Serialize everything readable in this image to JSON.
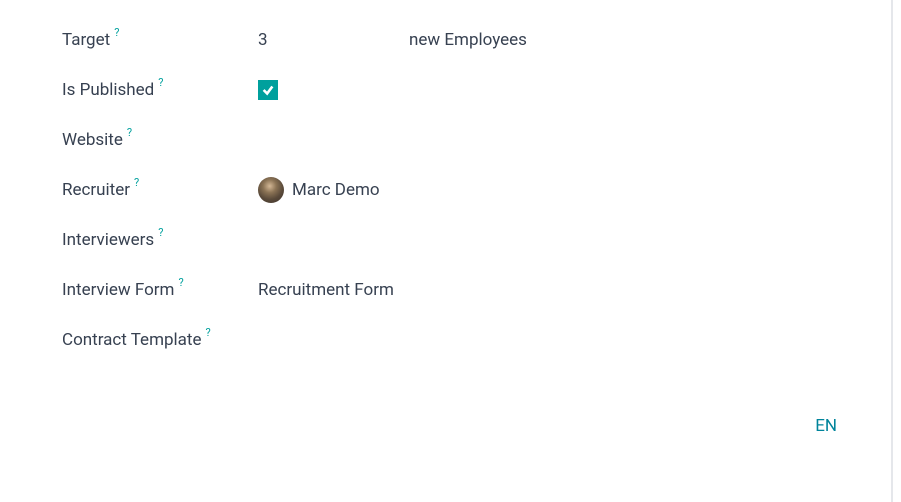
{
  "fields": {
    "target": {
      "label": "Target",
      "value": "3",
      "suffix": "new Employees"
    },
    "is_published": {
      "label": "Is Published",
      "checked": true
    },
    "website": {
      "label": "Website",
      "value": ""
    },
    "recruiter": {
      "label": "Recruiter",
      "name": "Marc Demo"
    },
    "interviewers": {
      "label": "Interviewers",
      "value": ""
    },
    "interview_form": {
      "label": "Interview Form",
      "value": "Recruitment Form"
    },
    "contract_template": {
      "label": "Contract Template",
      "value": ""
    }
  },
  "help_marker": "?",
  "language_badge": "EN"
}
